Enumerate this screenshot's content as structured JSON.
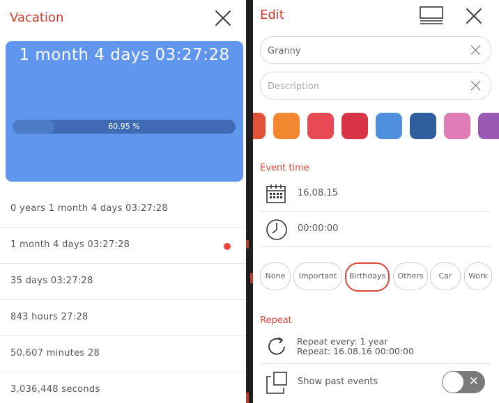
{
  "left_panel": {
    "title": "Vacation",
    "countdown": "1 month 4 days 03:27:28",
    "progress_label": "60.95 %",
    "progress_fraction": 0.6095,
    "rows": [
      {
        "text": "0 years 1 month 4 days 03:27:28",
        "selected": false
      },
      {
        "text": "1 month 4 days 03:27:28",
        "selected": true
      },
      {
        "text": "35 days 03:27:28",
        "selected": false
      },
      {
        "text": "843 hours 27:28",
        "selected": false
      },
      {
        "text": "50,607 minutes 28",
        "selected": false
      },
      {
        "text": "3,036,448 seconds",
        "selected": false
      }
    ]
  },
  "right_panel": {
    "title": "Edit",
    "name_value": "Granny",
    "description_placeholder": "Description",
    "colors": [
      "#e0523a",
      "#f2872f",
      "#e84a55",
      "#d93446",
      "#4f8fde",
      "#2e5f9c",
      "#e07cb5",
      "#9b59b6",
      "#f3c64b"
    ],
    "event_time_label": "Event time",
    "date_value": "16.08.15",
    "time_value": "00:00:00",
    "categories": [
      "None",
      "Important",
      "Birthdays",
      "Others",
      "Car",
      "Work"
    ],
    "selected_category": "Birthdays",
    "repeat_label": "Repeat",
    "repeat_line1": "Repeat every: 1 year",
    "repeat_line2": "Repeat: 16.08.16 00:00:00",
    "show_past_label": "Show past events",
    "show_past_enabled": false
  },
  "accent": "#d9473a",
  "card_color": "#6096ee"
}
